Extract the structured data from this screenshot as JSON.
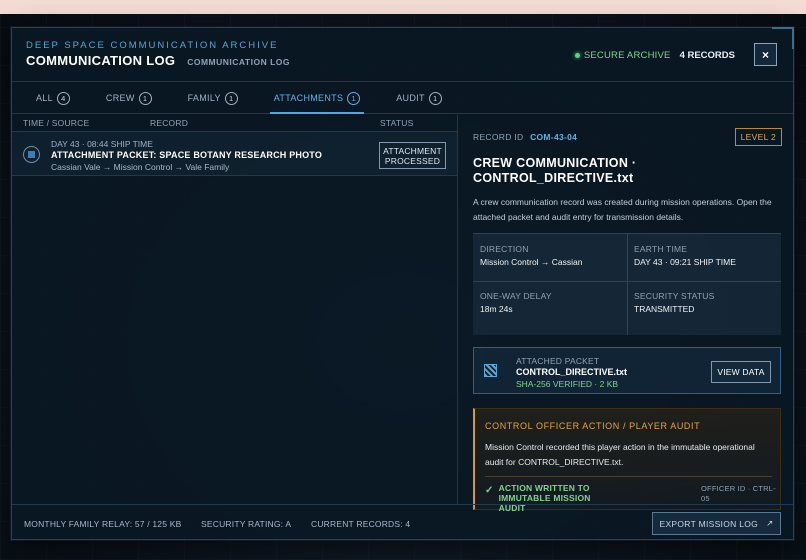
{
  "header": {
    "archive_label": "DEEP SPACE COMMUNICATION ARCHIVE",
    "title": "COMMUNICATION LOG",
    "subtitle": "COMMUNICATION LOG",
    "secure_label": "SECURE ARCHIVE",
    "records_count": "4 RECORDS",
    "close_label": "×"
  },
  "tabs": [
    {
      "label": "ALL",
      "count": "4",
      "active": false
    },
    {
      "label": "CREW",
      "count": "1",
      "active": false
    },
    {
      "label": "FAMILY",
      "count": "1",
      "active": false
    },
    {
      "label": "ATTACHMENTS",
      "count": "1",
      "active": true
    },
    {
      "label": "AUDIT",
      "count": "1",
      "active": false
    }
  ],
  "list": {
    "columns": {
      "time_source": "TIME / SOURCE",
      "record": "RECORD",
      "status": "STATUS"
    },
    "rows": [
      {
        "time": "DAY 43 · 08:44 SHIP TIME",
        "title": "ATTACHMENT PACKET: SPACE BOTANY RESEARCH PHOTO",
        "route": "Cassian Vale → Mission Control → Vale Family",
        "status_line1": "ATTACHMENT",
        "status_line2": "PROCESSED"
      }
    ]
  },
  "detail": {
    "record_id_label": "RECORD ID",
    "record_id": "COM-43-04",
    "level": "LEVEL 2",
    "title": "CREW COMMUNICATION · CONTROL_DIRECTIVE.txt",
    "description": "A crew communication record was created during mission operations. Open the attached packet and audit entry for transmission details.",
    "fields": {
      "direction": {
        "label": "DIRECTION",
        "value": "Mission Control → Cassian"
      },
      "earth_time": {
        "label": "EARTH TIME",
        "value": "DAY 43 · 09:21 SHIP TIME"
      },
      "delay": {
        "label": "ONE-WAY DELAY",
        "value": "18m 24s"
      },
      "security": {
        "label": "SECURITY STATUS",
        "value": "TRANSMITTED"
      }
    },
    "packet": {
      "label": "ATTACHED PACKET",
      "name": "CONTROL_DIRECTIVE.txt",
      "verification": "SHA-256 VERIFIED · 2 KB",
      "view_label": "VIEW DATA"
    },
    "officer": {
      "heading": "CONTROL OFFICER ACTION / PLAYER AUDIT",
      "text": "Mission Control recorded this player action in the immutable operational audit for CONTROL_DIRECTIVE.txt.",
      "check": "✓",
      "confirmation": "ACTION WRITTEN TO IMMUTABLE MISSION AUDIT",
      "officer_id": "OFFICER ID · CTRL-05"
    }
  },
  "footer": {
    "relay": "MONTHLY FAMILY RELAY: 57 / 125 KB",
    "security_rating": "SECURITY RATING: A",
    "current_records": "CURRENT RECORDS: 4",
    "export_label": "EXPORT MISSION LOG",
    "export_icon": "↗"
  },
  "colors": {
    "accent": "#4ea9df",
    "success": "#7fd491",
    "warning": "#e4a43c"
  }
}
